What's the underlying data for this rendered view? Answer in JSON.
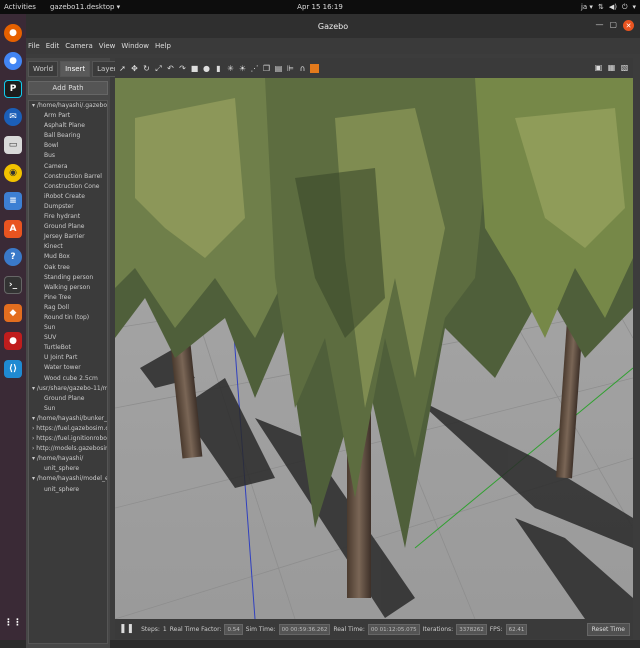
{
  "topbar": {
    "activities": "Activities",
    "app_menu": "gazebo11.desktop ▾",
    "clock": "Apr 15  16:19",
    "lang": "ja ▾"
  },
  "window": {
    "title": "Gazebo"
  },
  "menu": [
    "File",
    "Edit",
    "Camera",
    "View",
    "Window",
    "Help"
  ],
  "left_panel": {
    "tabs": [
      "World",
      "Insert",
      "Layers"
    ],
    "active_tab": "Insert",
    "add_path_label": "Add Path",
    "tree": [
      {
        "level": 0,
        "text": "▾ /home/hayashi/.gazebo/model..."
      },
      {
        "level": 1,
        "text": "Arm Part"
      },
      {
        "level": 1,
        "text": "Asphalt Plane"
      },
      {
        "level": 1,
        "text": "Ball Bearing"
      },
      {
        "level": 1,
        "text": "Bowl"
      },
      {
        "level": 1,
        "text": "Bus"
      },
      {
        "level": 1,
        "text": "Camera"
      },
      {
        "level": 1,
        "text": "Construction Barrel"
      },
      {
        "level": 1,
        "text": "Construction Cone"
      },
      {
        "level": 1,
        "text": "iRobot Create"
      },
      {
        "level": 1,
        "text": "Dumpster"
      },
      {
        "level": 1,
        "text": "Fire hydrant"
      },
      {
        "level": 1,
        "text": "Ground Plane"
      },
      {
        "level": 1,
        "text": "Jersey Barrier"
      },
      {
        "level": 1,
        "text": "Kinect"
      },
      {
        "level": 1,
        "text": "Mud Box"
      },
      {
        "level": 1,
        "text": "Oak tree"
      },
      {
        "level": 1,
        "text": "Standing person"
      },
      {
        "level": 1,
        "text": "Walking person"
      },
      {
        "level": 1,
        "text": "Pine Tree"
      },
      {
        "level": 1,
        "text": "Rag Doll"
      },
      {
        "level": 1,
        "text": "Round tin (top)"
      },
      {
        "level": 1,
        "text": "Sun"
      },
      {
        "level": 1,
        "text": "SUV"
      },
      {
        "level": 1,
        "text": "TurtleBot"
      },
      {
        "level": 1,
        "text": "U Joint Part"
      },
      {
        "level": 1,
        "text": "Water tower"
      },
      {
        "level": 1,
        "text": "Wood cube 2.5cm"
      },
      {
        "level": 0,
        "text": "▾ /usr/share/gazebo-11/models/"
      },
      {
        "level": 1,
        "text": "Ground Plane"
      },
      {
        "level": 1,
        "text": "Sun"
      },
      {
        "level": 0,
        "text": "▾ /home/hayashi/bunker_ws_t..."
      },
      {
        "level": 0,
        "text": "› https://fuel.gazebosim.org"
      },
      {
        "level": 0,
        "text": "› https://fuel.ignitionrobotics..."
      },
      {
        "level": 0,
        "text": "› http://models.gazebosim.org/"
      },
      {
        "level": 0,
        "text": "▾ /home/hayashi/"
      },
      {
        "level": 1,
        "text": "unit_sphere"
      },
      {
        "level": 0,
        "text": "▾ /home/hayashi/model_edito..."
      },
      {
        "level": 1,
        "text": "unit_sphere"
      }
    ]
  },
  "bottom": {
    "steps_label": "Steps:",
    "steps_value": "1",
    "rtf_label": "Real Time Factor:",
    "rtf_value": "0.54",
    "simtime_label": "Sim Time:",
    "simtime_value": "00 00:59:36.262",
    "realtime_label": "Real Time:",
    "realtime_value": "00 01:12:05.075",
    "iter_label": "Iterations:",
    "iter_value": "3378262",
    "fps_label": "FPS:",
    "fps_value": "62.41",
    "reset_label": "Reset Time"
  }
}
